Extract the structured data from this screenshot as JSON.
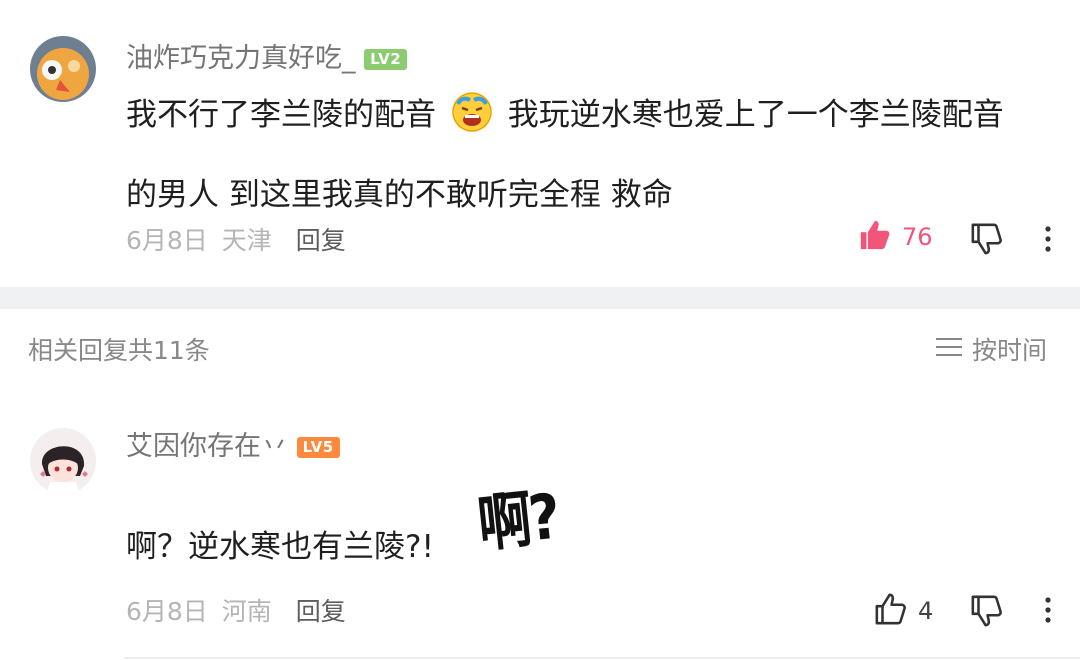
{
  "comment": {
    "username": "油炸巧克力真好吃_",
    "level": "LV2",
    "text_line1_a": "我不行了李兰陵的配音",
    "text_line1_b": "我玩逆水寒也爱上了一个李兰陵配音",
    "text_line2": "的男人 到这里我真的不敢听完全程 救命",
    "date": "6月8日",
    "location": "天津",
    "reply_label": "回复",
    "like_count": "76",
    "colors": {
      "like_active": "#f2557a"
    }
  },
  "replies_header": {
    "title": "相关回复共11条",
    "sort_label": "按时间"
  },
  "reply": {
    "username": "艾因你存在丷",
    "level": "LV5",
    "text": "啊？逆水寒也有兰陵?!",
    "sticker_text": "啊?",
    "date": "6月8日",
    "location": "河南",
    "reply_label": "回复",
    "like_count": "4"
  }
}
